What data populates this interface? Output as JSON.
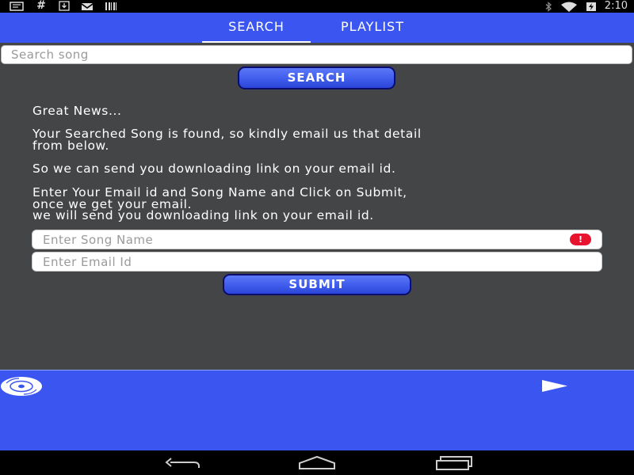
{
  "status_bar": {
    "time": "2:10",
    "left_icons": [
      "message-icon",
      "hash-icon",
      "download-icon",
      "mail-icon",
      "barcode-icon"
    ],
    "right_icons": [
      "bluetooth-icon",
      "wifi-icon",
      "battery-icon"
    ]
  },
  "tabs": [
    {
      "label": "SEARCH",
      "active": true
    },
    {
      "label": "PLAYLIST",
      "active": false
    }
  ],
  "search": {
    "placeholder": "Search song",
    "button_label": "SEARCH"
  },
  "message": {
    "line1": "Great News...",
    "line2": "Your Searched Song is found, so kindly email us that detail",
    "line3": "from below.",
    "line4": "So we can send you downloading link on your email id.",
    "line5": "Enter Your Email id and Song Name and Click on Submit,",
    "line6": "once we get your email.",
    "line7": "we will send you downloading link on your email id."
  },
  "form": {
    "song_placeholder": "Enter Song Name",
    "email_placeholder": "Enter Email Id",
    "error_symbol": "!",
    "submit_label": "SUBMIT"
  },
  "player": {
    "disc_icon": "disc-icon",
    "play_icon": "play-icon"
  },
  "nav_bar": {
    "icons": [
      "back-icon",
      "home-icon",
      "recent-apps-icon"
    ]
  },
  "colors": {
    "accent": "#3b56f0",
    "content_bg": "#434547",
    "button_border": "#0b0d6e",
    "error": "#e8132e"
  }
}
